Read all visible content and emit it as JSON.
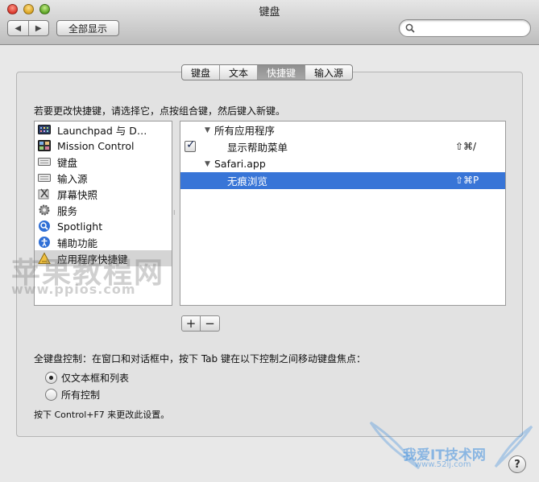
{
  "window": {
    "title": "键盘"
  },
  "toolbar": {
    "back_icon": "◀",
    "forward_icon": "▶",
    "show_all_label": "全部显示",
    "search_placeholder": ""
  },
  "tabs": [
    {
      "label": "键盘",
      "active": false
    },
    {
      "label": "文本",
      "active": false
    },
    {
      "label": "快捷键",
      "active": true
    },
    {
      "label": "输入源",
      "active": false
    }
  ],
  "instruction": "若要更改快捷键，请选择它，点按组合键，然后键入新键。",
  "categories": [
    {
      "label": "Launchpad 与 D…",
      "icon": "launchpad-icon"
    },
    {
      "label": "Mission Control",
      "icon": "mission-control-icon"
    },
    {
      "label": "键盘",
      "icon": "keyboard-icon"
    },
    {
      "label": "输入源",
      "icon": "input-source-icon"
    },
    {
      "label": "屏幕快照",
      "icon": "screenshot-icon"
    },
    {
      "label": "服务",
      "icon": "gear-icon"
    },
    {
      "label": "Spotlight",
      "icon": "spotlight-icon"
    },
    {
      "label": "辅助功能",
      "icon": "accessibility-icon"
    },
    {
      "label": "应用程序快捷键",
      "icon": "app-shortcuts-icon",
      "selected": true
    }
  ],
  "shortcuts": {
    "group1": {
      "label": "所有应用程序",
      "disclosure": "▼"
    },
    "item1": {
      "label": "显示帮助菜单",
      "shortcut": "⇧⌘/",
      "checked": true
    },
    "group2": {
      "label": "Safari.app",
      "disclosure": "▼"
    },
    "item2": {
      "label": "无痕浏览",
      "shortcut": "⇧⌘P",
      "selected": true
    }
  },
  "buttons": {
    "add": "+",
    "remove": "−"
  },
  "keyboard_control": {
    "label": "全键盘控制：在窗口和对话框中，按下 Tab 键在以下控制之间移动键盘焦点：",
    "options": [
      {
        "label": "仅文本框和列表",
        "selected": true
      },
      {
        "label": "所有控制",
        "selected": false
      }
    ],
    "hint": "按下 Control+F7 来更改此设置。"
  },
  "help_label": "?",
  "watermarks": {
    "top_text": "苹果教程网",
    "top_url": "www.ppios.com",
    "bottom_text": "我爱IT技术网",
    "bottom_url": "www.52ij.com"
  },
  "colors": {
    "selection": "#3875d7",
    "panel": "#e2e2e2",
    "window_bg": "#e8e8e8"
  }
}
